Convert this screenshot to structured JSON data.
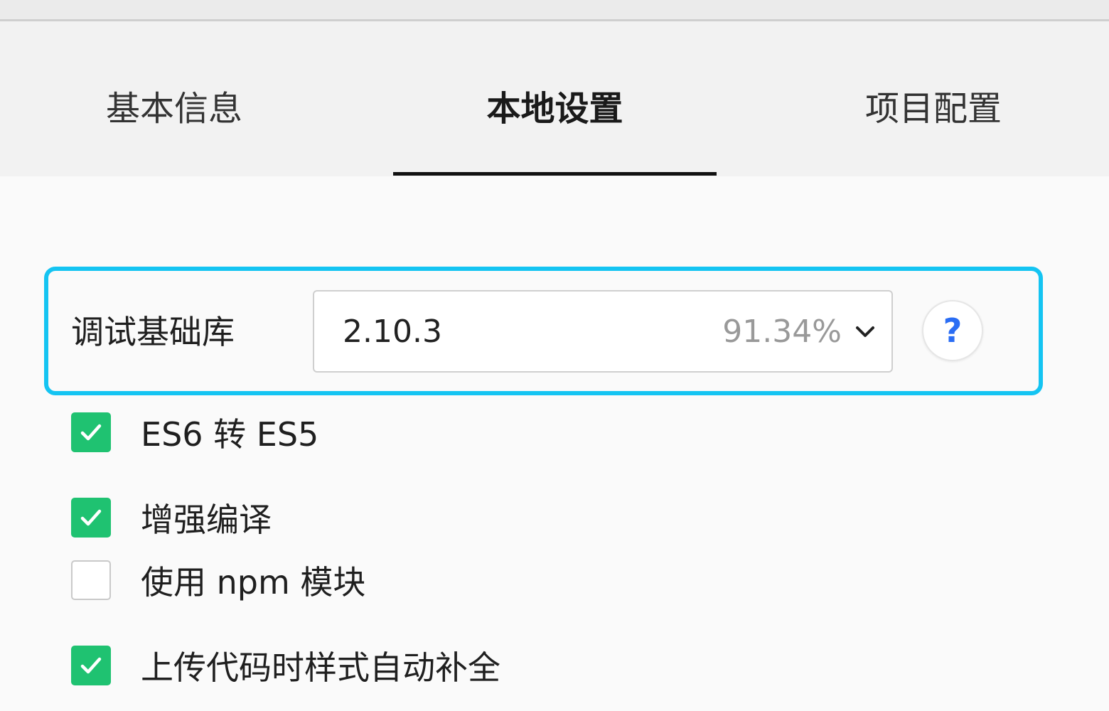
{
  "tabs": [
    {
      "label": "基本信息",
      "active": false
    },
    {
      "label": "本地设置",
      "active": true
    },
    {
      "label": "项目配置",
      "active": false
    }
  ],
  "debug_lib": {
    "label": "调试基础库",
    "selected_version": "2.10.3",
    "coverage": "91.34%",
    "help_label": "?"
  },
  "options": [
    {
      "label": "ES6 转 ES5",
      "checked": true
    },
    {
      "label": "增强编译",
      "checked": true
    },
    {
      "label": "使用 npm 模块",
      "checked": false
    },
    {
      "label": "上传代码时样式自动补全",
      "checked": true
    }
  ],
  "colors": {
    "focus_ring": "#14c4f2",
    "checkbox_checked": "#1fc271",
    "help_icon": "#2a6df4"
  }
}
